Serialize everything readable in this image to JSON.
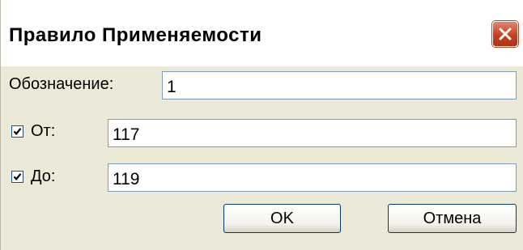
{
  "window": {
    "title": "Правило Применяемости",
    "close_icon": "close-icon"
  },
  "form": {
    "designation_label": "Обозначение:",
    "designation_value": "1",
    "from_checked": true,
    "from_label": "От:",
    "from_value": "117",
    "to_checked": true,
    "to_label": "До:",
    "to_value": "119"
  },
  "buttons": {
    "ok_label": "OK",
    "cancel_label": "Отмена"
  },
  "colors": {
    "dialog_bg": "#ece9d8",
    "close_button": "#c4401e",
    "field_border": "#7f9db9",
    "button_border": "#003c74"
  }
}
